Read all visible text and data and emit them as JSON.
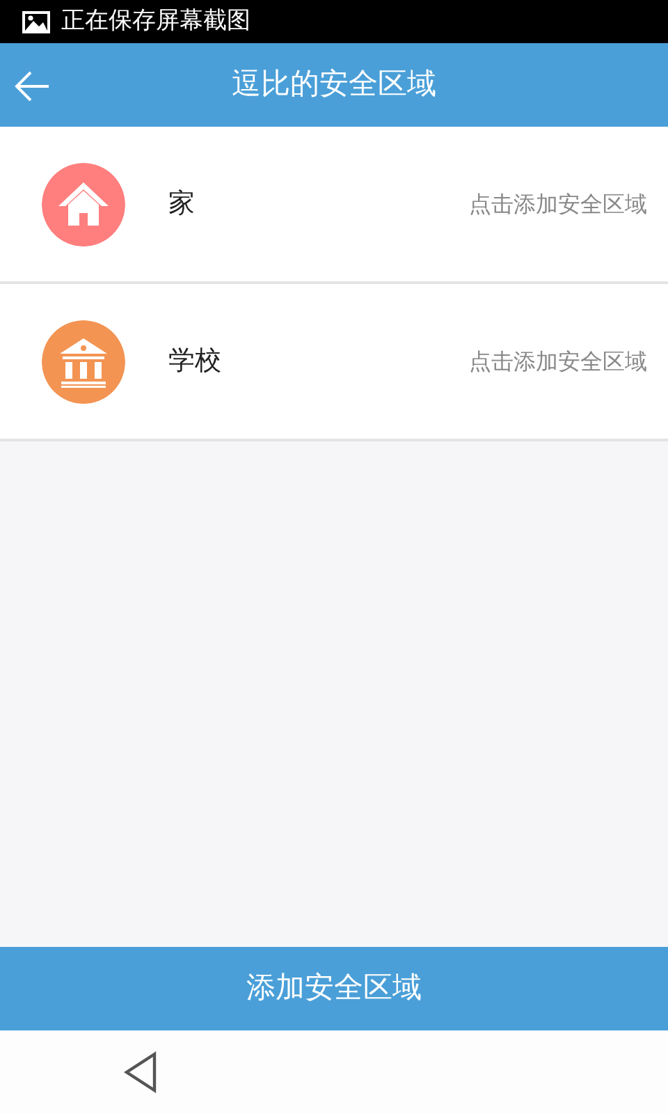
{
  "status_bar": {
    "notification": "正在保存屏幕截图"
  },
  "header": {
    "title": "逗比的安全区域"
  },
  "zones": [
    {
      "kind": "home",
      "name": "家",
      "hint": "点击添加安全区域",
      "color": "#fe7f7e"
    },
    {
      "kind": "school",
      "name": "学校",
      "hint": "点击添加安全区域",
      "color": "#f39453"
    }
  ],
  "footer_button": "添加安全区域"
}
